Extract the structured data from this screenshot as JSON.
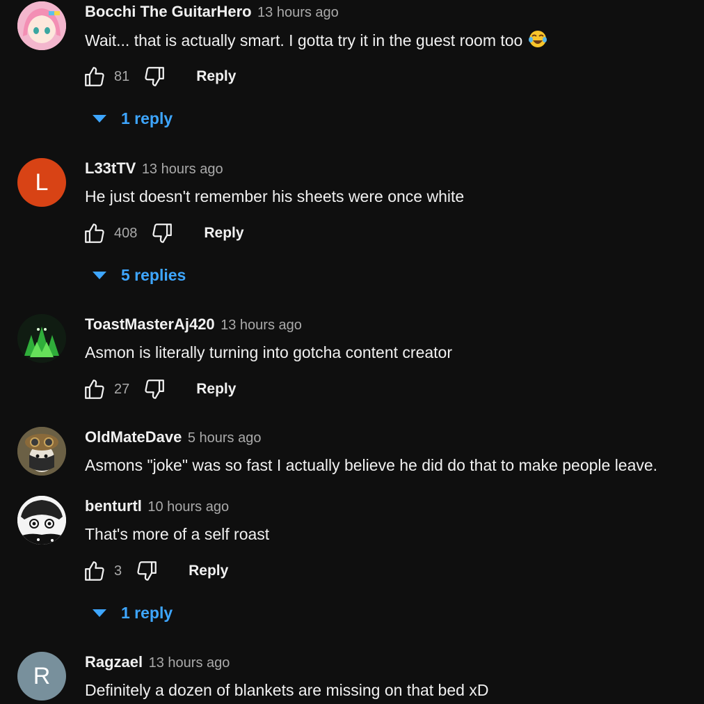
{
  "colors": {
    "background": "#0f0f0f",
    "text": "#f1f1f1",
    "muted": "#aaaaaa",
    "link": "#3ea6ff"
  },
  "reply_label": "Reply",
  "comments": [
    {
      "author": "Bocchi The GuitarHero",
      "time": "13 hours ago",
      "text": "Wait... that is actually smart. I gotta try it in the guest room too",
      "emoji": "face-with-tears-of-joy-icon",
      "likes": "81",
      "replies": "1 reply",
      "avatar": {
        "type": "anime-pink-hair-avatar"
      }
    },
    {
      "author": "L33tTV",
      "time": "13 hours ago",
      "text": "He just doesn't remember his sheets were once white",
      "likes": "408",
      "replies": "5 replies",
      "avatar": {
        "type": "letter",
        "letter": "L",
        "color": "#d84315"
      }
    },
    {
      "author": "ToastMasterAj420",
      "time": "13 hours ago",
      "text": "Asmon is literally turning into gotcha content creator",
      "likes": "27",
      "avatar": {
        "type": "green-creature-avatar"
      }
    },
    {
      "author": "OldMateDave",
      "time": "5 hours ago",
      "text": "Asmons \"joke\" was so fast I actually believe he did do that to make people leave.",
      "avatar": {
        "type": "cat-with-goggles-avatar"
      }
    },
    {
      "author": "benturtl",
      "time": "10 hours ago",
      "text": "That's more of a self roast",
      "likes": "3",
      "replies": "1 reply",
      "avatar": {
        "type": "manga-sketch-avatar"
      }
    },
    {
      "author": "Ragzael",
      "time": "13 hours ago",
      "text": "Definitely a dozen of blankets are missing on that bed xD",
      "avatar": {
        "type": "letter",
        "letter": "R",
        "color": "#78909c"
      }
    }
  ]
}
